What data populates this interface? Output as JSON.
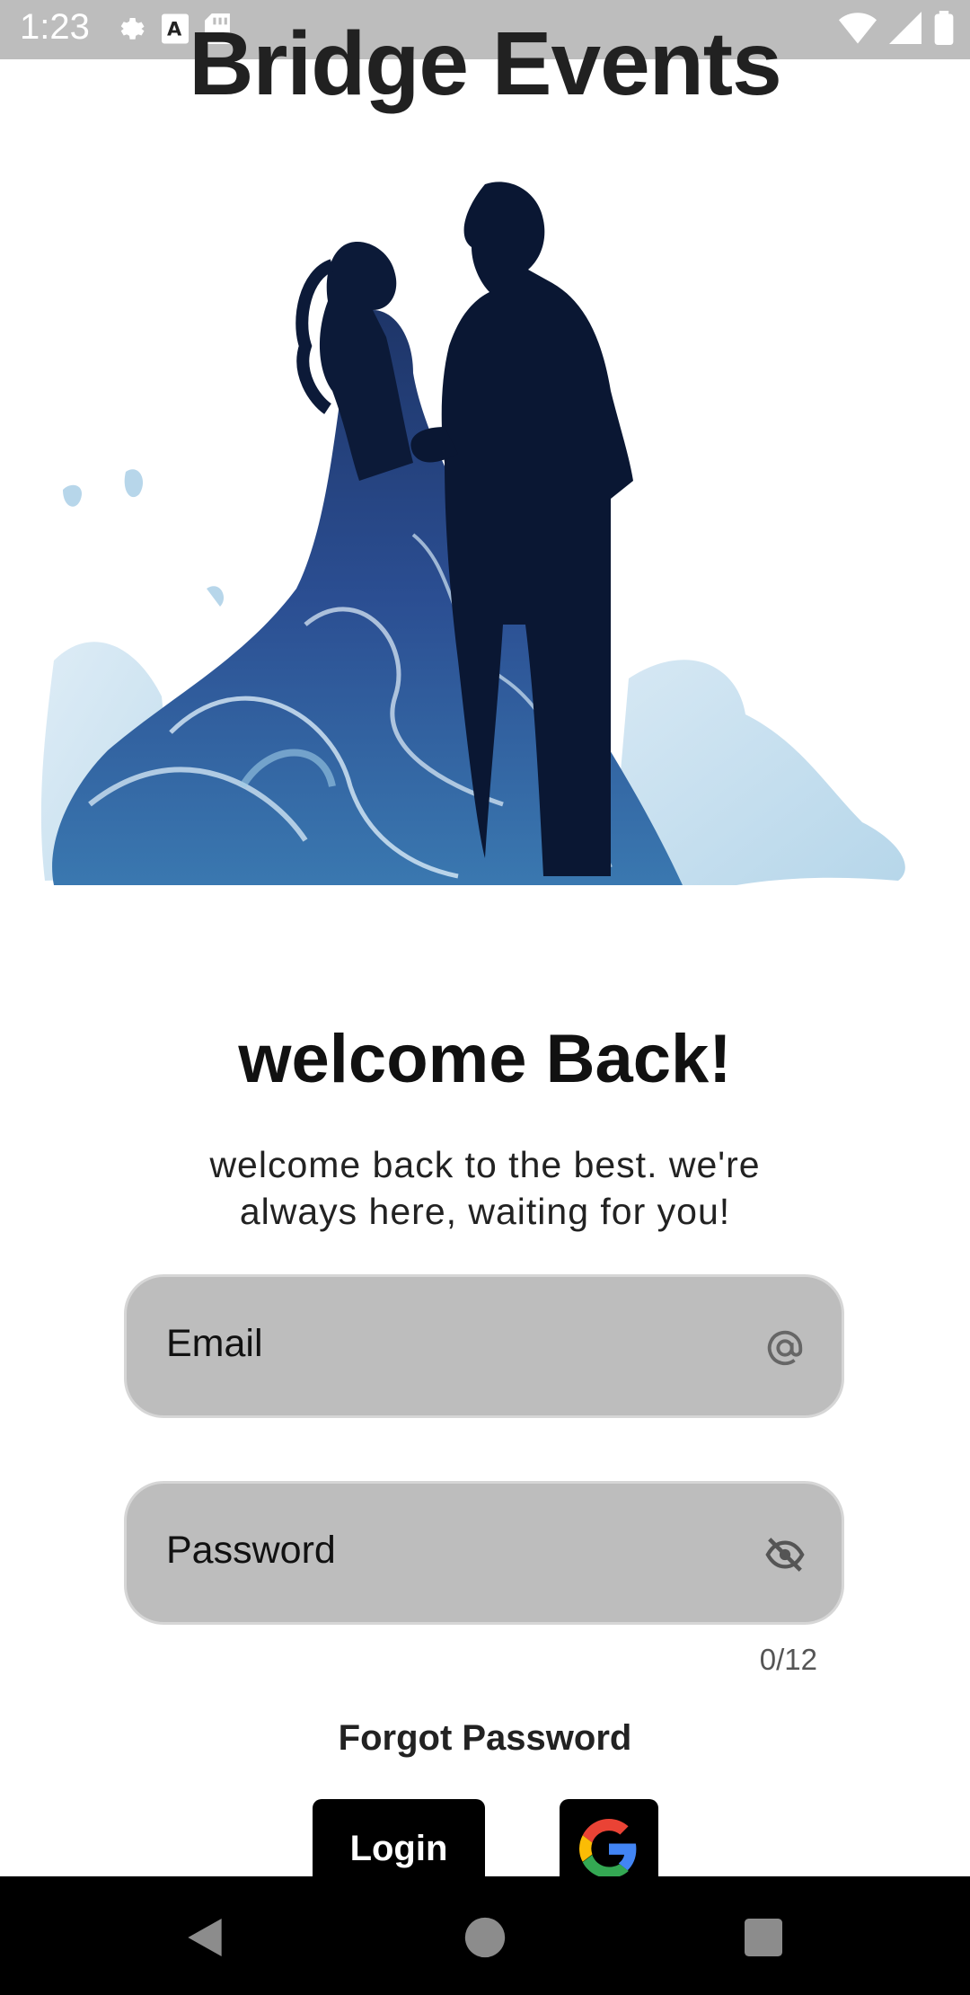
{
  "status_bar": {
    "time": "1:23",
    "left_icons": [
      "gear-icon",
      "accessibility-text-icon",
      "sd-card-icon"
    ],
    "right_icons": [
      "wifi-icon",
      "signal-icon",
      "battery-icon"
    ]
  },
  "app": {
    "title": "Bridge Events"
  },
  "hero": {
    "image": "couple-silhouette-illustration"
  },
  "welcome": {
    "title": "welcome Back!",
    "subtitle": "welcome back to the best. we're always here, waiting for you!"
  },
  "form": {
    "email": {
      "label": "Email",
      "icon": "at-icon"
    },
    "password": {
      "label": "Password",
      "icon": "visibility-off-icon",
      "counter": "0/12"
    },
    "forgot_label": "Forgot Password",
    "login_label": "Login",
    "google_icon": "google-icon"
  },
  "nav": {
    "buttons": [
      "back-icon",
      "home-icon",
      "recents-icon"
    ]
  },
  "colors": {
    "field_bg": "#bdbdbd",
    "button_bg": "#000000",
    "text": "#111111"
  }
}
